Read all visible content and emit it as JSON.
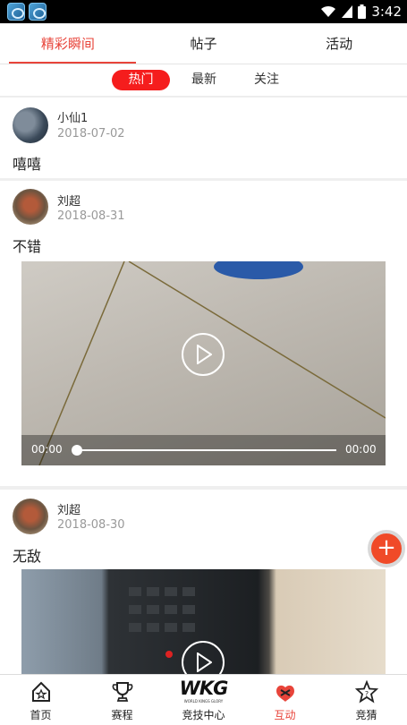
{
  "status_bar": {
    "time": "3:42"
  },
  "top_tabs": [
    {
      "label": "精彩瞬间",
      "active": true
    },
    {
      "label": "帖子",
      "active": false
    },
    {
      "label": "活动",
      "active": false
    }
  ],
  "sub_tabs": [
    {
      "label": "热门",
      "active": true
    },
    {
      "label": "最新",
      "active": false
    },
    {
      "label": "关注",
      "active": false
    }
  ],
  "posts": [
    {
      "username": "小仙1",
      "date": "2018-07-02",
      "text": "嘻嘻"
    },
    {
      "username": "刘超",
      "date": "2018-08-31",
      "text": "不错",
      "video": {
        "current_time": "00:00",
        "duration": "00:00",
        "progress": 0
      }
    },
    {
      "username": "刘超",
      "date": "2018-08-30",
      "text": "无敌"
    }
  ],
  "fab": {
    "icon": "plus-icon"
  },
  "bottom_nav": [
    {
      "label": "首页",
      "icon": "home-icon",
      "active": false
    },
    {
      "label": "赛程",
      "icon": "trophy-icon",
      "active": false
    },
    {
      "label": "竞技中心",
      "logo": "WKG",
      "logo_sub": "WORLD KINGS GLORY",
      "active": false
    },
    {
      "label": "互动",
      "icon": "interact-icon",
      "active": true
    },
    {
      "label": "竞猜",
      "icon": "guess-star-icon",
      "active": false
    }
  ],
  "colors": {
    "accent": "#e8443a",
    "chip": "#f51d1d",
    "fab": "#f04a28"
  }
}
